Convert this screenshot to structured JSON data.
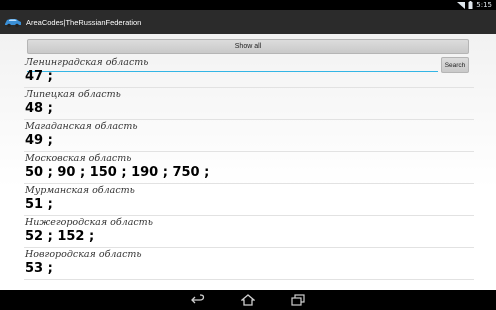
{
  "status": {
    "time": "5:15"
  },
  "app": {
    "title": "AreaCodes|TheRussianFederation",
    "icon": "car-icon"
  },
  "toolbar": {
    "show_all_label": "Show all",
    "search_label": "Search",
    "search_value": ""
  },
  "list": {
    "partial_top_region": "Ленинградская область",
    "items": [
      {
        "codes": "47 ;"
      },
      {
        "region": "Липецкая область",
        "codes": "48 ;"
      },
      {
        "region": "Магаданская область",
        "codes": "49 ;"
      },
      {
        "region": "Московская область",
        "codes": "50 ; 90 ; 150 ; 190 ; 750 ;"
      },
      {
        "region": "Мурманская область",
        "codes": "51 ;"
      },
      {
        "region": "Нижегородская область",
        "codes": "52 ; 152 ;"
      },
      {
        "region": "Новгородская область",
        "codes": "53 ;"
      }
    ]
  },
  "nav": {
    "back": "back-icon",
    "home": "home-icon",
    "recents": "recents-icon"
  },
  "colors": {
    "accent": "#33b5e5",
    "action_bar": "#2b2b2b"
  }
}
